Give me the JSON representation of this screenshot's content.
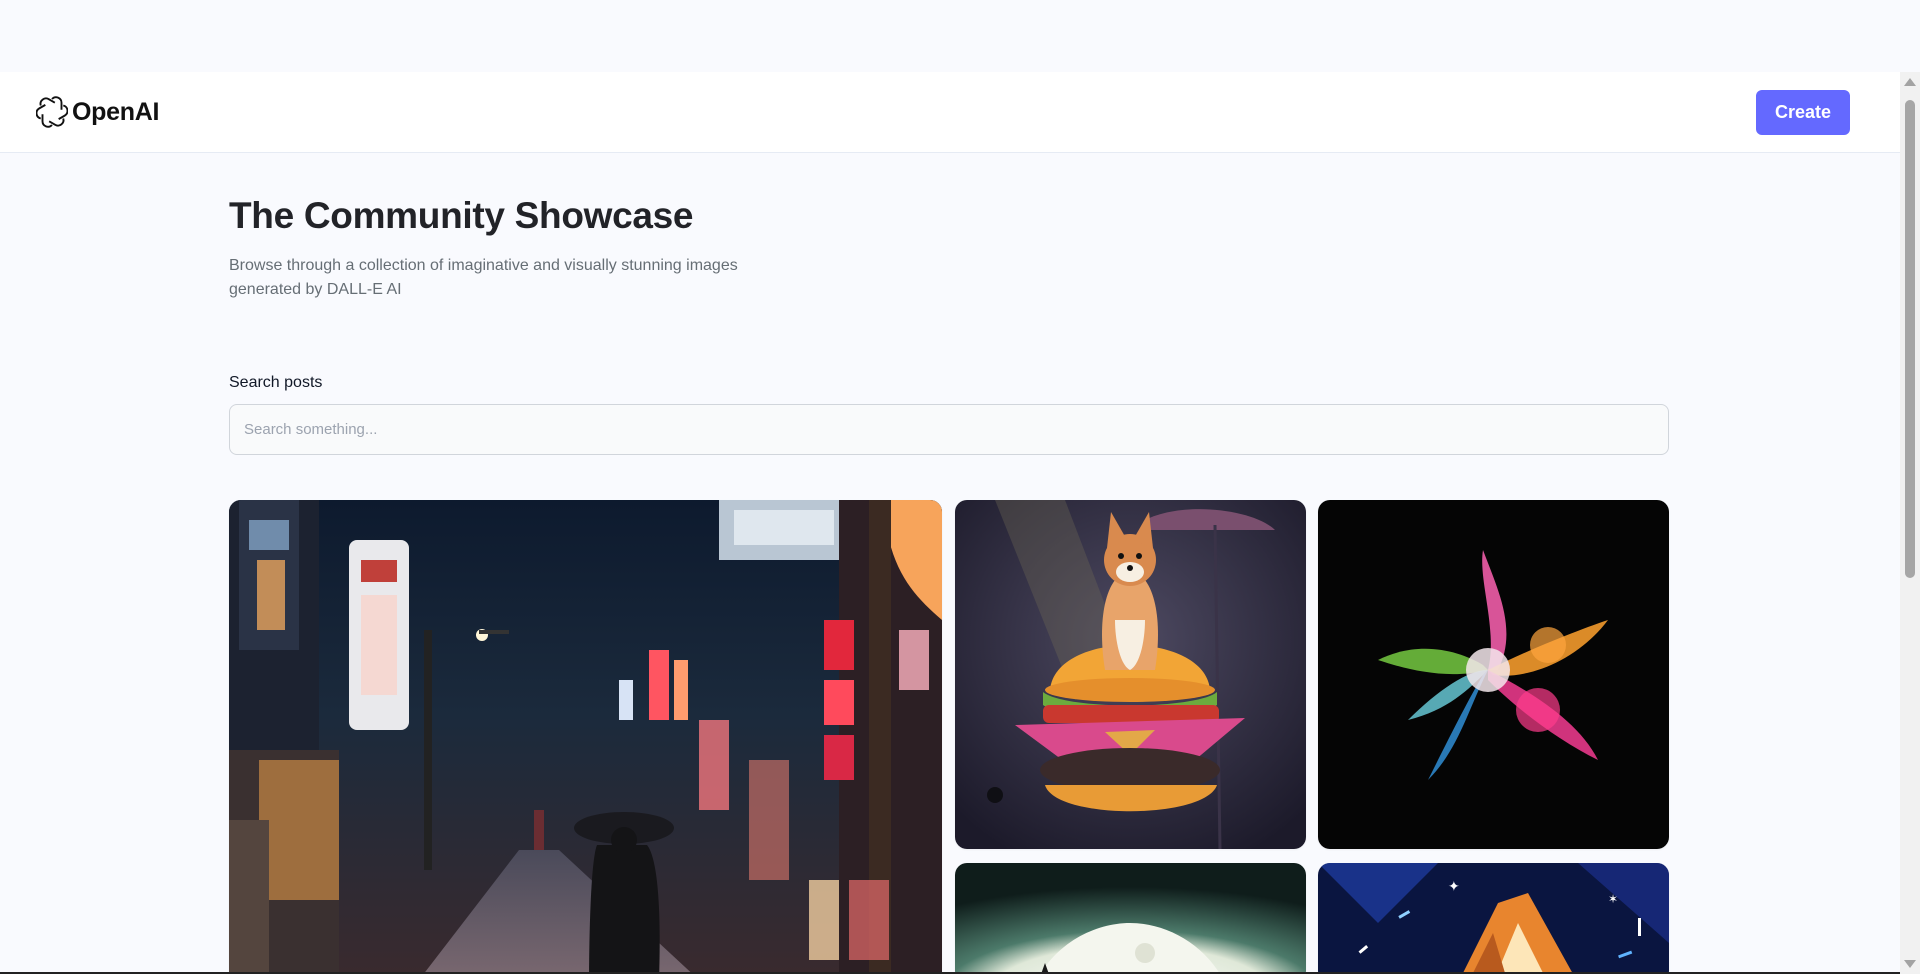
{
  "header": {
    "logo_text": "OpenAI",
    "logo_icon": "openai-logo-icon",
    "create_label": "Create",
    "accent_color": "#6469ff"
  },
  "main": {
    "title": "The Community Showcase",
    "subtitle": "Browse through a collection of imaginative and visually stunning images generated by DALL-E AI",
    "search": {
      "label": "Search posts",
      "placeholder": "Search something...",
      "value": ""
    }
  },
  "gallery": {
    "images": [
      {
        "subject": "night-city-street-rain"
      },
      {
        "subject": "shiba-dog-on-burger"
      },
      {
        "subject": "colorful-powder-explosion"
      },
      {
        "subject": "full-moon"
      },
      {
        "subject": "fox-in-space"
      }
    ]
  }
}
